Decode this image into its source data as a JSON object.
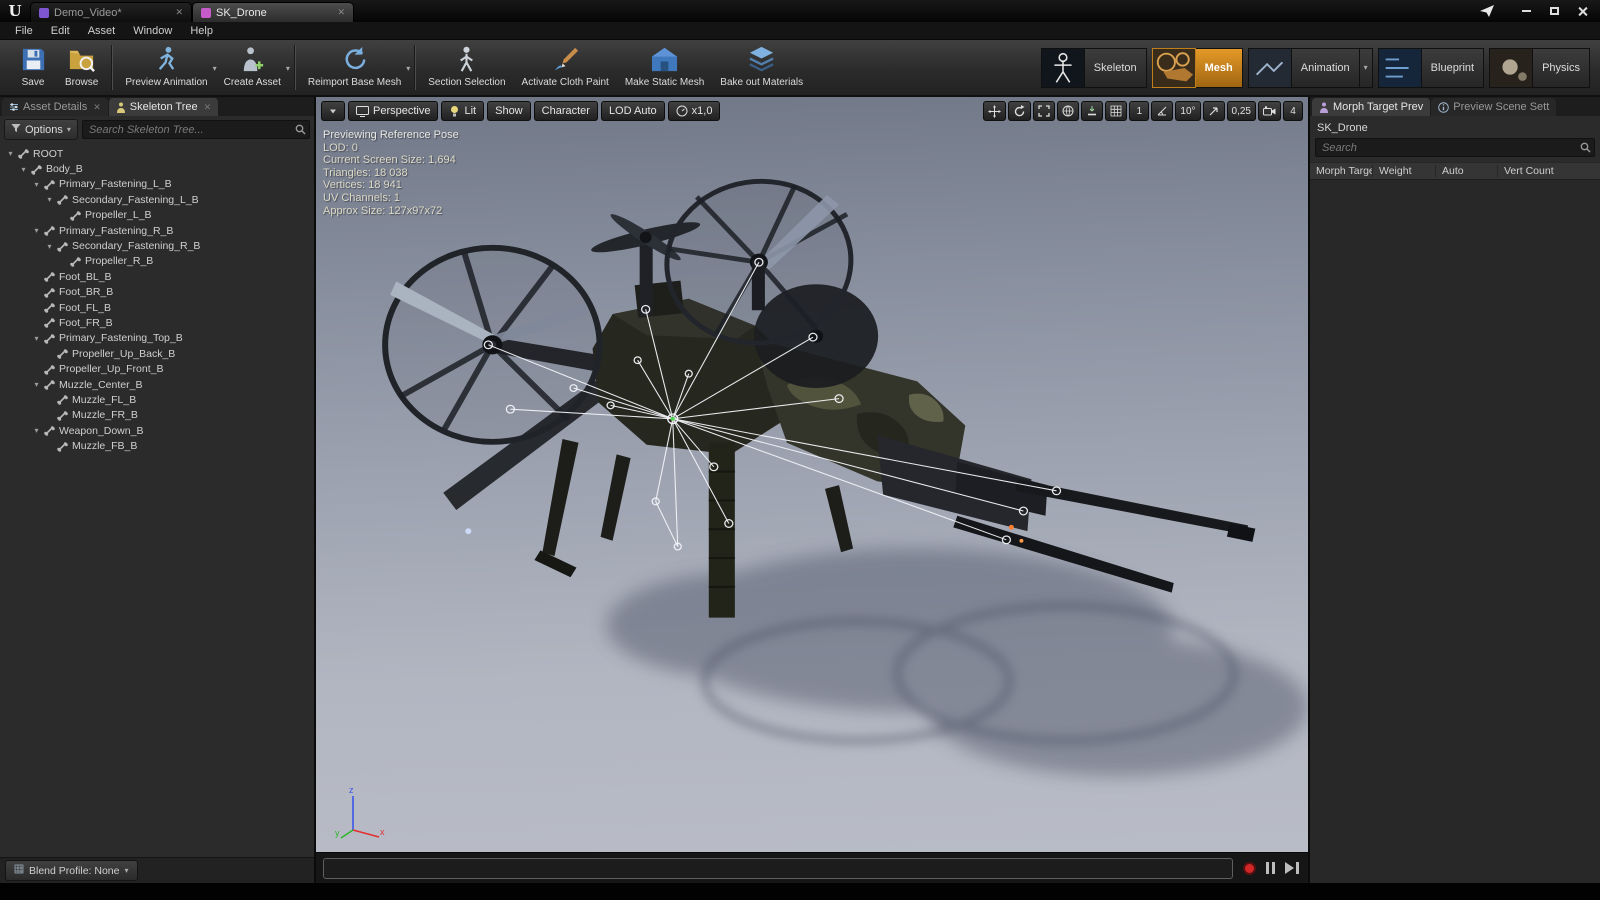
{
  "glyphs": {
    "close": "✕",
    "caret_down": "▾"
  },
  "window": {
    "logo": "U",
    "tabs": [
      {
        "label": "Demo_Video*",
        "active": false
      },
      {
        "label": "SK_Drone",
        "active": true
      }
    ],
    "menu": [
      "File",
      "Edit",
      "Asset",
      "Window",
      "Help"
    ]
  },
  "toolbar": {
    "groups": [
      {
        "items": [
          {
            "label": "Save",
            "icon": "save"
          },
          {
            "label": "Browse",
            "icon": "browse"
          }
        ]
      },
      {
        "items": [
          {
            "label": "Preview Animation",
            "icon": "preview-anim",
            "dropdown": true
          },
          {
            "label": "Create Asset",
            "icon": "create-asset",
            "dropdown": true
          }
        ]
      },
      {
        "items": [
          {
            "label": "Reimport Base Mesh",
            "icon": "reimport",
            "dropdown": true
          }
        ]
      },
      {
        "items": [
          {
            "label": "Section Selection",
            "icon": "section"
          },
          {
            "label": "Activate Cloth Paint",
            "icon": "cloth"
          },
          {
            "label": "Make Static Mesh",
            "icon": "staticmesh"
          },
          {
            "label": "Bake out Materials",
            "icon": "bake"
          }
        ]
      }
    ],
    "modes": [
      {
        "label": "Skeleton",
        "icon": "skeleton-thumb",
        "active": false
      },
      {
        "label": "Mesh",
        "icon": "mesh-thumb",
        "active": true
      },
      {
        "label": "Animation",
        "icon": "animation-thumb",
        "dropdown": true
      },
      {
        "label": "Blueprint",
        "icon": "blueprint-thumb"
      },
      {
        "label": "Physics",
        "icon": "physics-thumb"
      }
    ]
  },
  "left_panel": {
    "tabs": [
      {
        "label": "Asset Details",
        "icon": "sliders",
        "active": false
      },
      {
        "label": "Skeleton Tree",
        "icon": "person",
        "active": true
      }
    ],
    "options_label": "Options",
    "search_placeholder": "Search Skeleton Tree...",
    "blend_profile_label": "Blend Profile: None",
    "tree": [
      {
        "label": "ROOT",
        "depth": 0,
        "children": true
      },
      {
        "label": "Body_B",
        "depth": 1,
        "children": true
      },
      {
        "label": "Primary_Fastening_L_B",
        "depth": 2,
        "children": true
      },
      {
        "label": "Secondary_Fastening_L_B",
        "depth": 3,
        "children": true
      },
      {
        "label": "Propeller_L_B",
        "depth": 4,
        "children": false
      },
      {
        "label": "Primary_Fastening_R_B",
        "depth": 2,
        "children": true
      },
      {
        "label": "Secondary_Fastening_R_B",
        "depth": 3,
        "children": true
      },
      {
        "label": "Propeller_R_B",
        "depth": 4,
        "children": false
      },
      {
        "label": "Foot_BL_B",
        "depth": 2,
        "children": false
      },
      {
        "label": "Foot_BR_B",
        "depth": 2,
        "children": false
      },
      {
        "label": "Foot_FL_B",
        "depth": 2,
        "children": false
      },
      {
        "label": "Foot_FR_B",
        "depth": 2,
        "children": false
      },
      {
        "label": "Primary_Fastening_Top_B",
        "depth": 2,
        "children": true
      },
      {
        "label": "Propeller_Up_Back_B",
        "depth": 3,
        "children": false
      },
      {
        "label": "Propeller_Up_Front_B",
        "depth": 2,
        "children": false
      },
      {
        "label": "Muzzle_Center_B",
        "depth": 2,
        "children": true
      },
      {
        "label": "Muzzle_FL_B",
        "depth": 3,
        "children": false
      },
      {
        "label": "Muzzle_FR_B",
        "depth": 3,
        "children": false
      },
      {
        "label": "Weapon_Down_B",
        "depth": 2,
        "children": true
      },
      {
        "label": "Muzzle_FB_B",
        "depth": 3,
        "children": false
      }
    ]
  },
  "viewport": {
    "toolbar": [
      {
        "icon": "caret",
        "name": "viewport-options-menu"
      },
      {
        "label": "Perspective",
        "icon": "perspective",
        "name": "view-mode-button"
      },
      {
        "label": "Lit",
        "icon": "lit",
        "name": "lit-mode-button"
      },
      {
        "label": "Show",
        "name": "show-menu-button"
      },
      {
        "label": "Character",
        "name": "character-menu-button"
      },
      {
        "label": "LOD Auto",
        "name": "lod-menu-button"
      },
      {
        "label": "x1,0",
        "icon": "speed",
        "name": "playback-speed-button"
      }
    ],
    "right_toolbar": [
      {
        "icon": "translate",
        "name": "translate-tool-button"
      },
      {
        "icon": "rotate",
        "name": "rotate-tool-button"
      },
      {
        "icon": "maximize",
        "name": "maximize-viewport-button"
      },
      {
        "icon": "globe",
        "name": "coordinate-system-button"
      },
      {
        "icon": "surface-snap",
        "name": "surface-snap-toggle"
      },
      {
        "icon": "grid-snap",
        "name": "grid-snap-toggle"
      },
      {
        "label": "1",
        "name": "grid-snap-value"
      },
      {
        "icon": "angle-snap",
        "name": "rotation-snap-toggle"
      },
      {
        "label": "10°",
        "name": "rotation-snap-value"
      },
      {
        "icon": "scale-snap",
        "name": "scale-snap-toggle"
      },
      {
        "label": "0,25",
        "name": "scale-snap-value"
      },
      {
        "icon": "camera",
        "name": "camera-speed-button"
      },
      {
        "label": "4",
        "name": "camera-speed-value"
      }
    ],
    "stats": [
      "Previewing Reference Pose",
      "LOD: 0",
      "Current Screen Size: 1,694",
      "Triangles: 18 038",
      "Vertices: 18 941",
      "UV Channels: 1",
      "Approx Size: 127x97x72"
    ],
    "axis_labels": {
      "x": "x",
      "y": "y",
      "z": "z"
    }
  },
  "right_panel": {
    "tabs": [
      {
        "label": "Morph Target Prev",
        "icon": "person2",
        "active": true
      },
      {
        "label": "Preview Scene Sett",
        "icon": "info",
        "active": false
      }
    ],
    "asset_name": "SK_Drone",
    "search_placeholder": "Search",
    "columns": [
      "Morph Targe",
      "Weight",
      "Auto",
      "Vert Count"
    ]
  }
}
